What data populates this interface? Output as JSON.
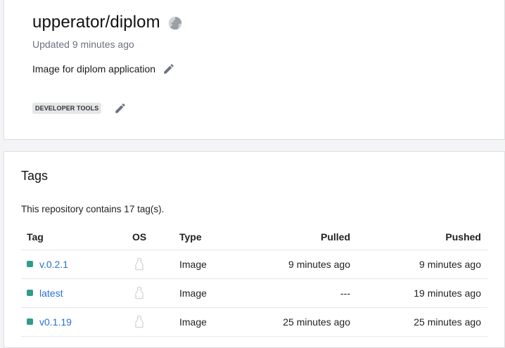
{
  "repo": {
    "name": "upperator/diplom",
    "updated": "Updated 9 minutes ago",
    "description": "Image for diplom application",
    "category": "DEVELOPER TOOLS"
  },
  "tags_section": {
    "title": "Tags",
    "count_text": "This repository contains 17 tag(s).",
    "columns": {
      "tag": "Tag",
      "os": "OS",
      "type": "Type",
      "pulled": "Pulled",
      "pushed": "Pushed"
    },
    "rows": [
      {
        "tag": "v.0.2.1",
        "os": "linux-icon",
        "type": "Image",
        "pulled": "9 minutes ago",
        "pushed": "9 minutes ago"
      },
      {
        "tag": "latest",
        "os": "linux-icon",
        "type": "Image",
        "pulled": "---",
        "pushed": "19 minutes ago"
      },
      {
        "tag": "v0.1.19",
        "os": "linux-icon",
        "type": "Image",
        "pulled": "25 minutes ago",
        "pushed": "25 minutes ago"
      }
    ]
  },
  "colors": {
    "link": "#2a6fce",
    "tag_dot": "#2e9d8a",
    "muted": "#6b7280"
  }
}
